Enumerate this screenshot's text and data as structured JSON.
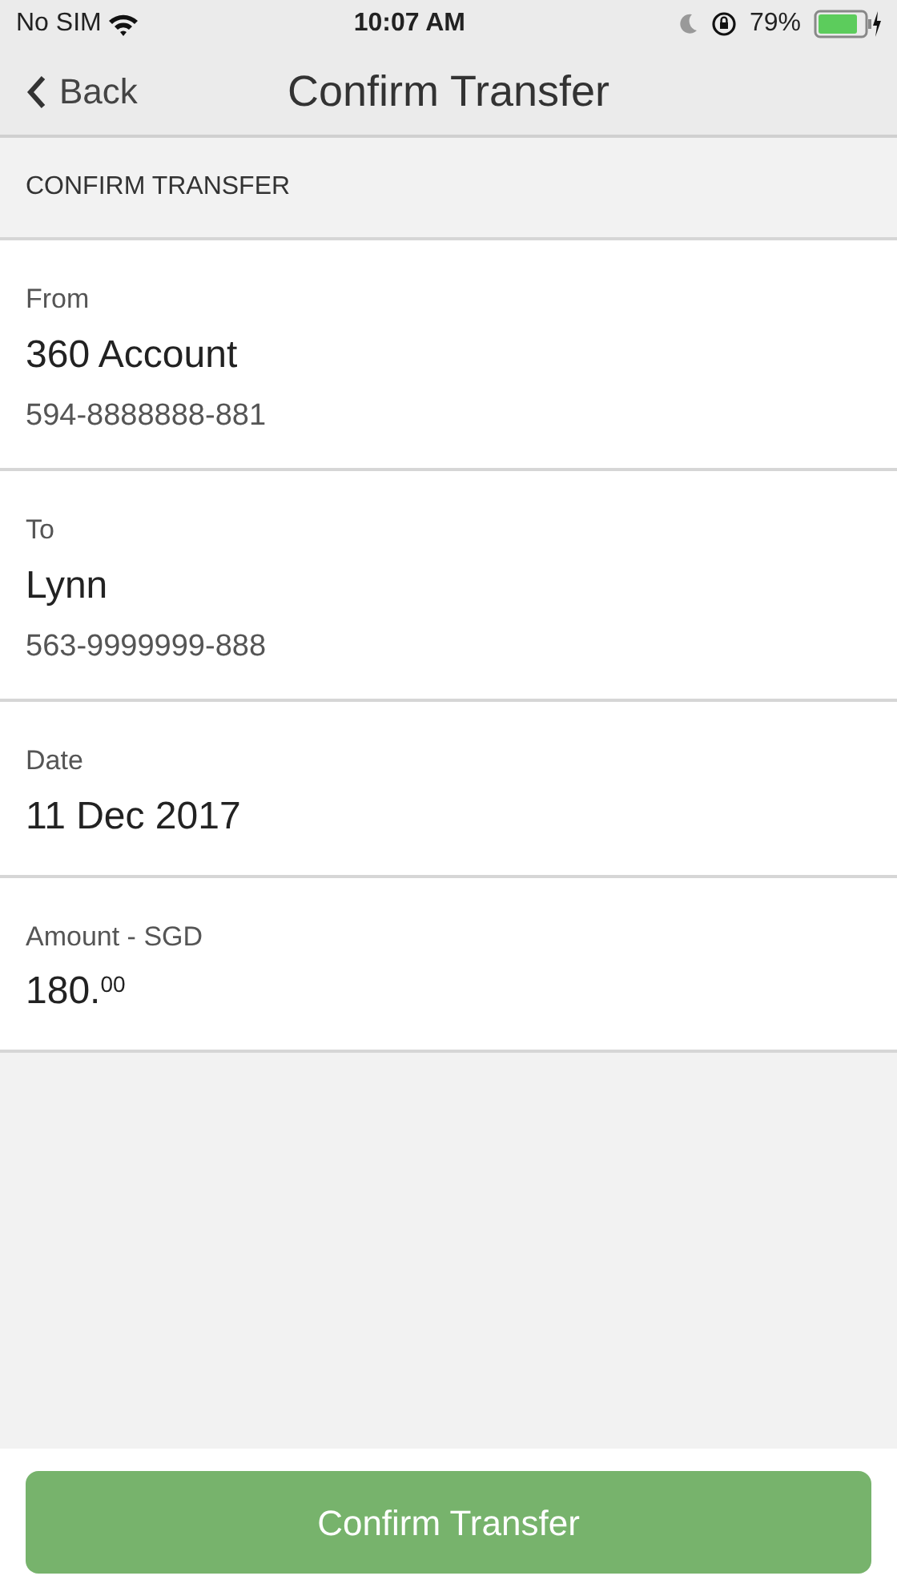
{
  "status_bar": {
    "carrier": "No SIM",
    "time": "10:07 AM",
    "battery": "79%"
  },
  "nav": {
    "back": "Back",
    "title": "Confirm Transfer"
  },
  "section": {
    "header": "CONFIRM TRANSFER"
  },
  "fields": [
    {
      "label": "From",
      "value": "360 Account",
      "detail": "594-8888888-881"
    },
    {
      "label": "To",
      "value": "Lynn",
      "detail": "563-9999999-888"
    },
    {
      "label": "Date",
      "value": "11 Dec 2017"
    },
    {
      "label": "Amount - SGD",
      "value": "180.$^{00}$"
    }
  ],
  "button": "Confirm Transfer"
}
